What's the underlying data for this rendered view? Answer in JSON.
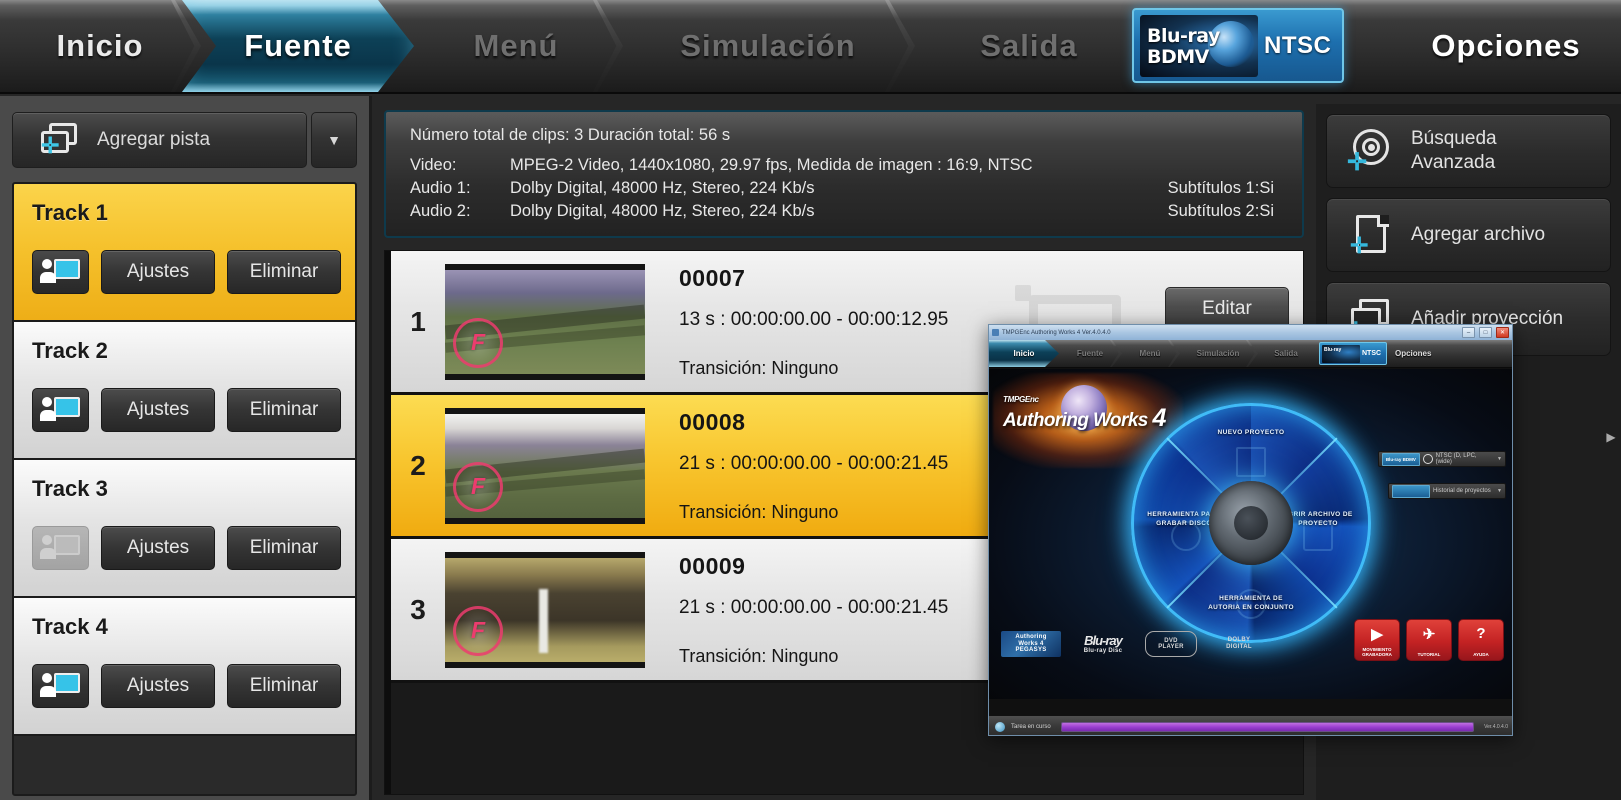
{
  "topnav": {
    "tabs": [
      {
        "label": "Inicio",
        "state": "normal"
      },
      {
        "label": "Fuente",
        "state": "active"
      },
      {
        "label": "Menú",
        "state": "dim"
      },
      {
        "label": "Simulación",
        "state": "dim"
      },
      {
        "label": "Salida",
        "state": "dim"
      },
      {
        "label": "Opciones",
        "state": "normal"
      }
    ],
    "format_badge": {
      "logo_line1": "Blu-ray",
      "logo_line2": "BDMV",
      "standard": "NTSC"
    }
  },
  "sidebar_left": {
    "add_track_label": "Agregar pista",
    "add_track_dropdown": "▼",
    "tracks": [
      {
        "name": "Track 1",
        "settings": "Ajustes",
        "delete": "Eliminar",
        "selected": true,
        "icon_enabled": true
      },
      {
        "name": "Track 2",
        "settings": "Ajustes",
        "delete": "Eliminar",
        "selected": false,
        "icon_enabled": true
      },
      {
        "name": "Track 3",
        "settings": "Ajustes",
        "delete": "Eliminar",
        "selected": false,
        "icon_enabled": false
      },
      {
        "name": "Track 4",
        "settings": "Ajustes",
        "delete": "Eliminar",
        "selected": false,
        "icon_enabled": true
      }
    ]
  },
  "info_panel": {
    "summary": "Número total de clips: 3     Duración total: 56 s",
    "video_label": "Video:",
    "video_value": "MPEG-2 Video,  1440x1080,  29.97  fps,  Medida de imagen : 16:9,  NTSC",
    "audio1_label": "Audio 1:",
    "audio1_value": "Dolby Digital,  48000  Hz,  Stereo,  224  Kb/s",
    "audio1_sub": "Subtítulos 1:Si",
    "audio2_label": "Audio 2:",
    "audio2_value": "Dolby Digital,  48000  Hz,  Stereo,  224  Kb/s",
    "audio2_sub": "Subtítulos 2:Si"
  },
  "clips": {
    "edit_label": "Editar",
    "rows": [
      {
        "index": "1",
        "name": "00007",
        "time": "13 s :  00:00:00.00 - 00:00:12.95",
        "transition": "Transición: Ninguno",
        "badge": "F",
        "selected": false
      },
      {
        "index": "2",
        "name": "00008",
        "time": "21 s :  00:00:00.00 - 00:00:21.45",
        "transition": "Transición: Ninguno",
        "badge": "F",
        "selected": true
      },
      {
        "index": "3",
        "name": "00009",
        "time": "21 s :  00:00:00.00 - 00:00:21.45",
        "transition": "Transición: Ninguno",
        "badge": "F",
        "selected": false
      }
    ]
  },
  "sidebar_right": {
    "buttons": [
      {
        "line1": "Búsqueda",
        "line2": "Avanzada",
        "icon": "advanced-search-icon"
      },
      {
        "line1": "Agregar archivo",
        "line2": "",
        "icon": "add-file-icon"
      },
      {
        "line1": "Añadir proyección",
        "line2": "",
        "icon": "add-projection-icon"
      }
    ]
  },
  "inner_window": {
    "title": "TMPGEnc Authoring Works 4  Ver.4.0.4.0",
    "window_buttons": {
      "minimize": "–",
      "maximize": "□",
      "close": "✕"
    },
    "nav_tabs": [
      {
        "label": "Inicio",
        "state": "active"
      },
      {
        "label": "Fuente",
        "state": "dim"
      },
      {
        "label": "Menú",
        "state": "dim"
      },
      {
        "label": "Simulación",
        "state": "dim"
      },
      {
        "label": "Salida",
        "state": "dim"
      },
      {
        "label": "Opciones",
        "state": "normal"
      }
    ],
    "badge": {
      "logo_line1": "Blu-ray",
      "logo_line2": "BDMV",
      "standard": "NTSC"
    },
    "logo": {
      "small": "TMPGEnc",
      "big": "Authoring Works",
      "version": "4"
    },
    "wheel": {
      "top": "NUEVO PROYECTO",
      "left": "HERRAMIENTA PARA GRABAR DISCO",
      "right": "ABRIR ARCHIVO DE PROYECTO",
      "bottom": "HERRAMIENTA DE AUTORIA EN CONJUNTO"
    },
    "dropdowns": [
      {
        "badge": "Blu-ray BDMV",
        "value": "NTSC  (D, LPC, (wide)"
      },
      {
        "badge": "",
        "value": "Historial de proyectos"
      }
    ],
    "logos": [
      {
        "id": "authoring-works-logo",
        "l1": "Authoring",
        "l2": "Works 4",
        "l3": "PEGASYS"
      },
      {
        "id": "bluray-disc-logo",
        "mark": "Blu-ray",
        "sub": "Blu-ray Disc"
      },
      {
        "id": "dvd-logo",
        "mark": "DVD",
        "sub": "PLAYER"
      },
      {
        "id": "dolby-logo",
        "mark": "DOLBY",
        "sub": "DIGITAL"
      }
    ],
    "red_buttons": [
      {
        "glyph": "▶",
        "label": "MOVIMIENTO GRABADORA"
      },
      {
        "glyph": "✈",
        "label": "TUTORIAL"
      },
      {
        "glyph": "?",
        "label": "AYUDA"
      }
    ],
    "status": {
      "text": "Tarea en curso",
      "progress_label": "",
      "right_text": "Ver.4.0.4.0"
    }
  }
}
